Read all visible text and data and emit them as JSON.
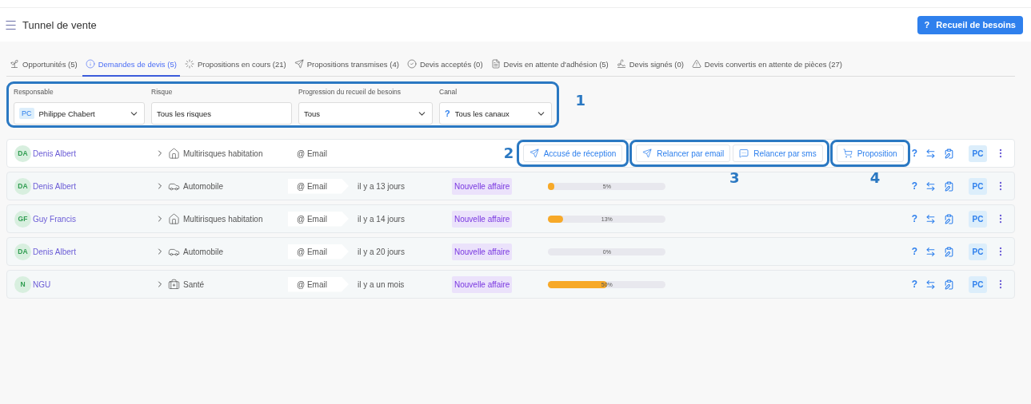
{
  "header": {
    "title": "Tunnel de vente",
    "button": {
      "glyph": "?",
      "label": "Recueil de besoins"
    }
  },
  "tabs": [
    {
      "label": "Opportunités (5)",
      "selected": false
    },
    {
      "label": "Demandes de devis (5)",
      "selected": true
    },
    {
      "label": "Propositions en cours (21)",
      "selected": false
    },
    {
      "label": "Propositions transmises (4)",
      "selected": false
    },
    {
      "label": "Devis acceptés (0)",
      "selected": false
    },
    {
      "label": "Devis en attente d'adhésion (5)",
      "selected": false
    },
    {
      "label": "Devis signés (0)",
      "selected": false
    },
    {
      "label": "Devis convertis en attente de pièces (27)",
      "selected": false
    }
  ],
  "filters": {
    "annotation": "1",
    "items": [
      {
        "kind": "person",
        "label": "Responsable",
        "badge": "PC",
        "value": "Philippe Chabert"
      },
      {
        "kind": "text",
        "label": "Risque",
        "value": "Tous les risques"
      },
      {
        "kind": "select",
        "label": "Progression du recueil de besoins",
        "value": "Tous"
      },
      {
        "kind": "channel",
        "label": "Canal",
        "glyph": "?",
        "value": "Tous les canaux"
      }
    ]
  },
  "rows": [
    {
      "kind": "actions",
      "initials": "DA",
      "name": "Denis Albert",
      "risk": "Multirisques habitation",
      "channel_at": "@",
      "channel": "Email",
      "help_glyph": "?",
      "owner": "PC",
      "groups": [
        {
          "annotation": "2",
          "buttons": [
            {
              "kind": "plane",
              "label": "Accusé de réception"
            }
          ]
        },
        {
          "annotation": "3",
          "buttons": [
            {
              "kind": "plane",
              "label": "Relancer par email"
            },
            {
              "kind": "chat",
              "label": "Relancer par sms"
            }
          ]
        },
        {
          "annotation": "4",
          "buttons": [
            {
              "kind": "cart",
              "label": "Proposition"
            }
          ]
        }
      ]
    },
    {
      "kind": "progress",
      "initials": "DA",
      "name": "Denis Albert",
      "risk": "Automobile",
      "channel_at": "@",
      "channel": "Email",
      "time": "il y a 13 jours",
      "tag": "Nouvelle affaire",
      "level": 0.05,
      "reading": "5%",
      "help_glyph": "?",
      "owner": "PC"
    },
    {
      "kind": "progress",
      "initials": "GF",
      "name": "Guy Francis",
      "risk": "Multirisques habitation",
      "channel_at": "@",
      "channel": "Email",
      "time": "il y a 14 jours",
      "tag": "Nouvelle affaire",
      "level": 0.13,
      "reading": "13%",
      "help_glyph": "?",
      "owner": "PC"
    },
    {
      "kind": "progress",
      "initials": "DA",
      "name": "Denis Albert",
      "risk": "Automobile",
      "channel_at": "@",
      "channel": "Email",
      "time": "il y a 20 jours",
      "tag": "Nouvelle affaire",
      "level": 0,
      "reading": "0%",
      "help_glyph": "?",
      "owner": "PC"
    },
    {
      "kind": "progress",
      "initials": "N",
      "name": "NGU",
      "risk": "Santé",
      "channel_at": "@",
      "channel": "Email",
      "time": "il y a un mois",
      "tag": "Nouvelle affaire",
      "level": 0.5,
      "reading": "50%",
      "help_glyph": "?",
      "owner": "PC"
    }
  ]
}
